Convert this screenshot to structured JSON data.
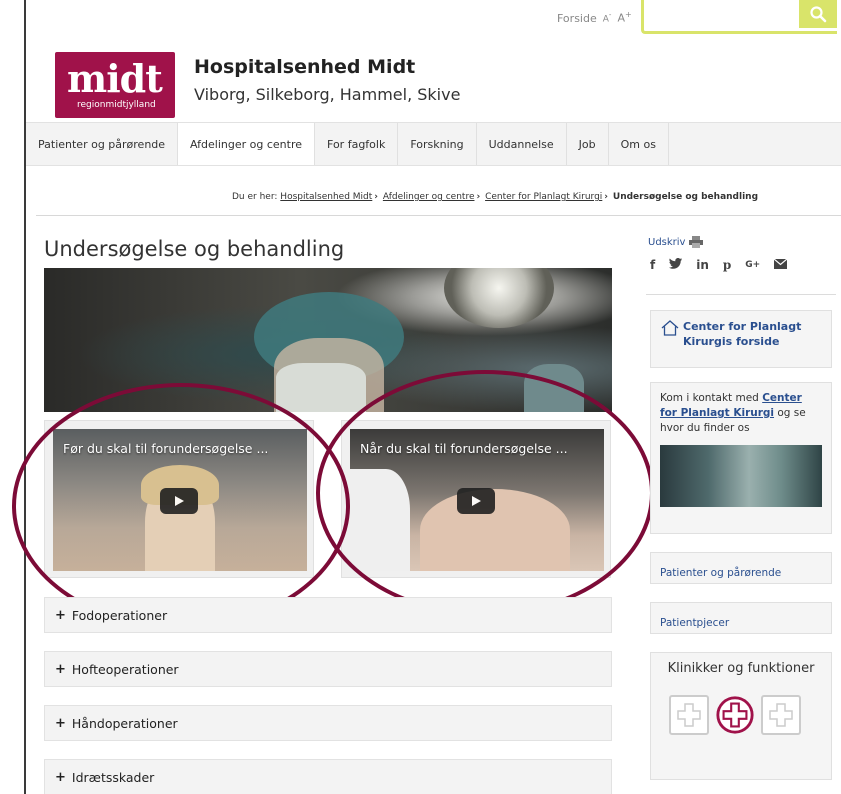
{
  "utility": {
    "home_label": "Forside",
    "text_smaller": "A",
    "text_larger": "A",
    "search_placeholder": ""
  },
  "logo": {
    "main": "midt",
    "sub": "regionmidtjylland"
  },
  "org": {
    "title": "Hospitalsenhed Midt",
    "subtitle": "Viborg, Silkeborg, Hammel, Skive"
  },
  "nav": [
    {
      "label": "Patienter og pårørende"
    },
    {
      "label": "Afdelinger og centre",
      "active": true
    },
    {
      "label": "For fagfolk"
    },
    {
      "label": "Forskning"
    },
    {
      "label": "Uddannelse"
    },
    {
      "label": "Job"
    },
    {
      "label": "Om os"
    }
  ],
  "breadcrumb": {
    "prefix": "Du er her:",
    "items": [
      "Hospitalsenhed Midt",
      "Afdelinger og centre",
      "Center for Planlagt Kirurgi"
    ],
    "current": "Undersøgelse og behandling"
  },
  "page_title": "Undersøgelse og behandling",
  "videos": [
    {
      "title": "Før du skal til forundersøgelse ..."
    },
    {
      "title": "Når du skal til forundersøgelse ..."
    }
  ],
  "accordion": [
    {
      "label": "Fodoperationer"
    },
    {
      "label": "Hofteoperationer"
    },
    {
      "label": "Håndoperationer"
    },
    {
      "label": "Idrætsskader"
    }
  ],
  "sidebar": {
    "print_label": "Udskriv",
    "social": [
      "f",
      "t",
      "in",
      "p",
      "G+",
      "mail"
    ],
    "home_link": "Center for Planlagt Kirurgis forside",
    "contact_prefix": "Kom i kontakt med",
    "contact_link": "Center for Planlagt Kirurgi",
    "contact_suffix": "og se hvor du finder os",
    "links": [
      "Patienter og pårørende",
      "Patientpjecer"
    ],
    "klinikker_title": "Klinikker og funktioner"
  },
  "colors": {
    "brand": "#a0124a",
    "accent_search": "#d9e46a",
    "link": "#2a4f8f",
    "highlight_ring": "#7c0b37"
  }
}
